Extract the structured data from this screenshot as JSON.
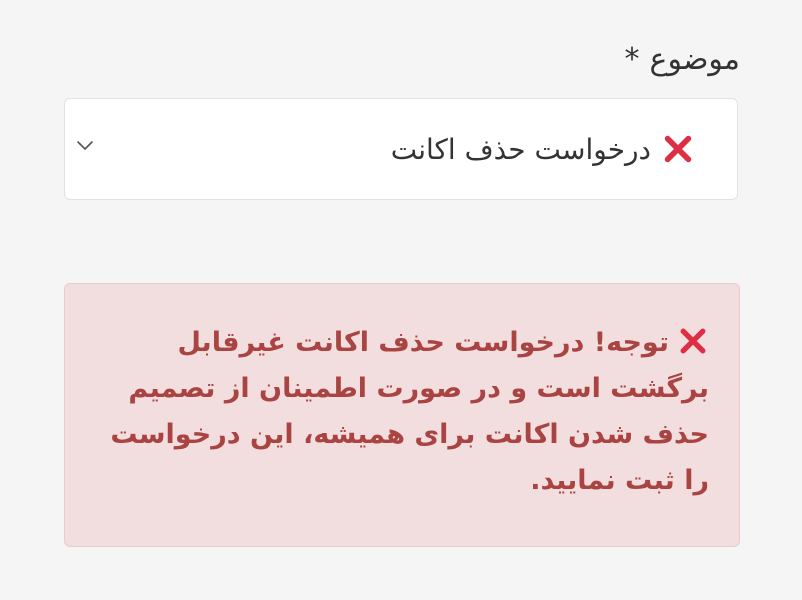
{
  "form": {
    "subject_label": "موضوع",
    "required_mark": "*",
    "subject_select": {
      "selected_value": "درخواست حذف اکانت",
      "icon": "cross-mark-icon"
    }
  },
  "alert": {
    "icon": "cross-mark-icon",
    "message": "توجه! درخواست حذف اکانت غیرقابل برگشت است و در صورت اطمینان از تصمیم حذف شدن اکانت برای همیشه، این درخواست را ثبت نمایید."
  },
  "colors": {
    "alert_background": "#f2dede",
    "alert_text": "#a94442",
    "cross_icon": "#dd2e44"
  }
}
